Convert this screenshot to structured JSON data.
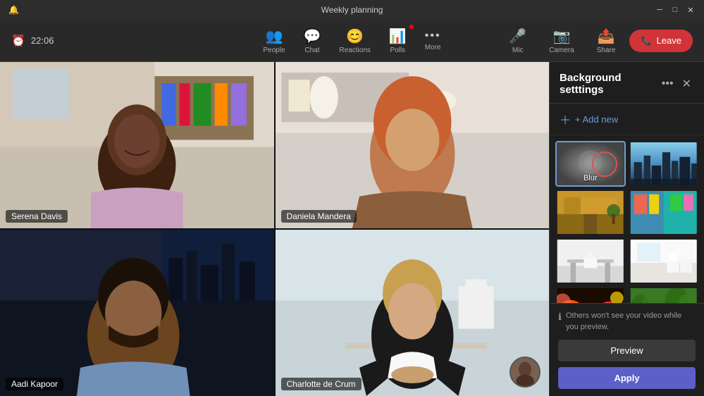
{
  "window": {
    "title": "Weekly planning",
    "controls": [
      "minimize",
      "maximize",
      "close"
    ]
  },
  "toolbar": {
    "time": "22:06",
    "buttons": [
      {
        "id": "people",
        "icon": "👥",
        "label": "People"
      },
      {
        "id": "chat",
        "icon": "💬",
        "label": "Chat"
      },
      {
        "id": "reactions",
        "icon": "😊",
        "label": "Reactions"
      },
      {
        "id": "polls",
        "icon": "📊",
        "label": "Polls"
      },
      {
        "id": "more",
        "icon": "•••",
        "label": "More"
      }
    ],
    "right_buttons": [
      {
        "id": "mic",
        "icon": "🎤",
        "label": "Mic"
      },
      {
        "id": "camera",
        "icon": "📷",
        "label": "Camera"
      },
      {
        "id": "share",
        "icon": "📤",
        "label": "Share"
      }
    ],
    "leave_label": "Leave"
  },
  "participants": [
    {
      "name": "Serena Davis",
      "position": "top-left"
    },
    {
      "name": "Daniela Mandera",
      "position": "top-right"
    },
    {
      "name": "Aadi Kapoor",
      "position": "bottom-left"
    },
    {
      "name": "Charlotte de Crum",
      "position": "bottom-right"
    }
  ],
  "bg_panel": {
    "title": "Background setttings",
    "add_new_label": "+ Add new",
    "thumbnails": [
      {
        "id": "blur",
        "label": "Blur",
        "type": "blur"
      },
      {
        "id": "city",
        "label": "City skyline",
        "type": "city"
      },
      {
        "id": "office1",
        "label": "Office warm",
        "type": "office1"
      },
      {
        "id": "office2",
        "label": "Colorful office",
        "type": "office2"
      },
      {
        "id": "white1",
        "label": "White minimal",
        "type": "white1"
      },
      {
        "id": "white2",
        "label": "White office",
        "type": "white2"
      },
      {
        "id": "balls",
        "label": "Colorful balls",
        "type": "balls"
      },
      {
        "id": "nature",
        "label": "Nature",
        "type": "nature"
      }
    ],
    "info_text": "Others won't see your video while you preview.",
    "preview_label": "Preview",
    "apply_label": "Apply"
  }
}
